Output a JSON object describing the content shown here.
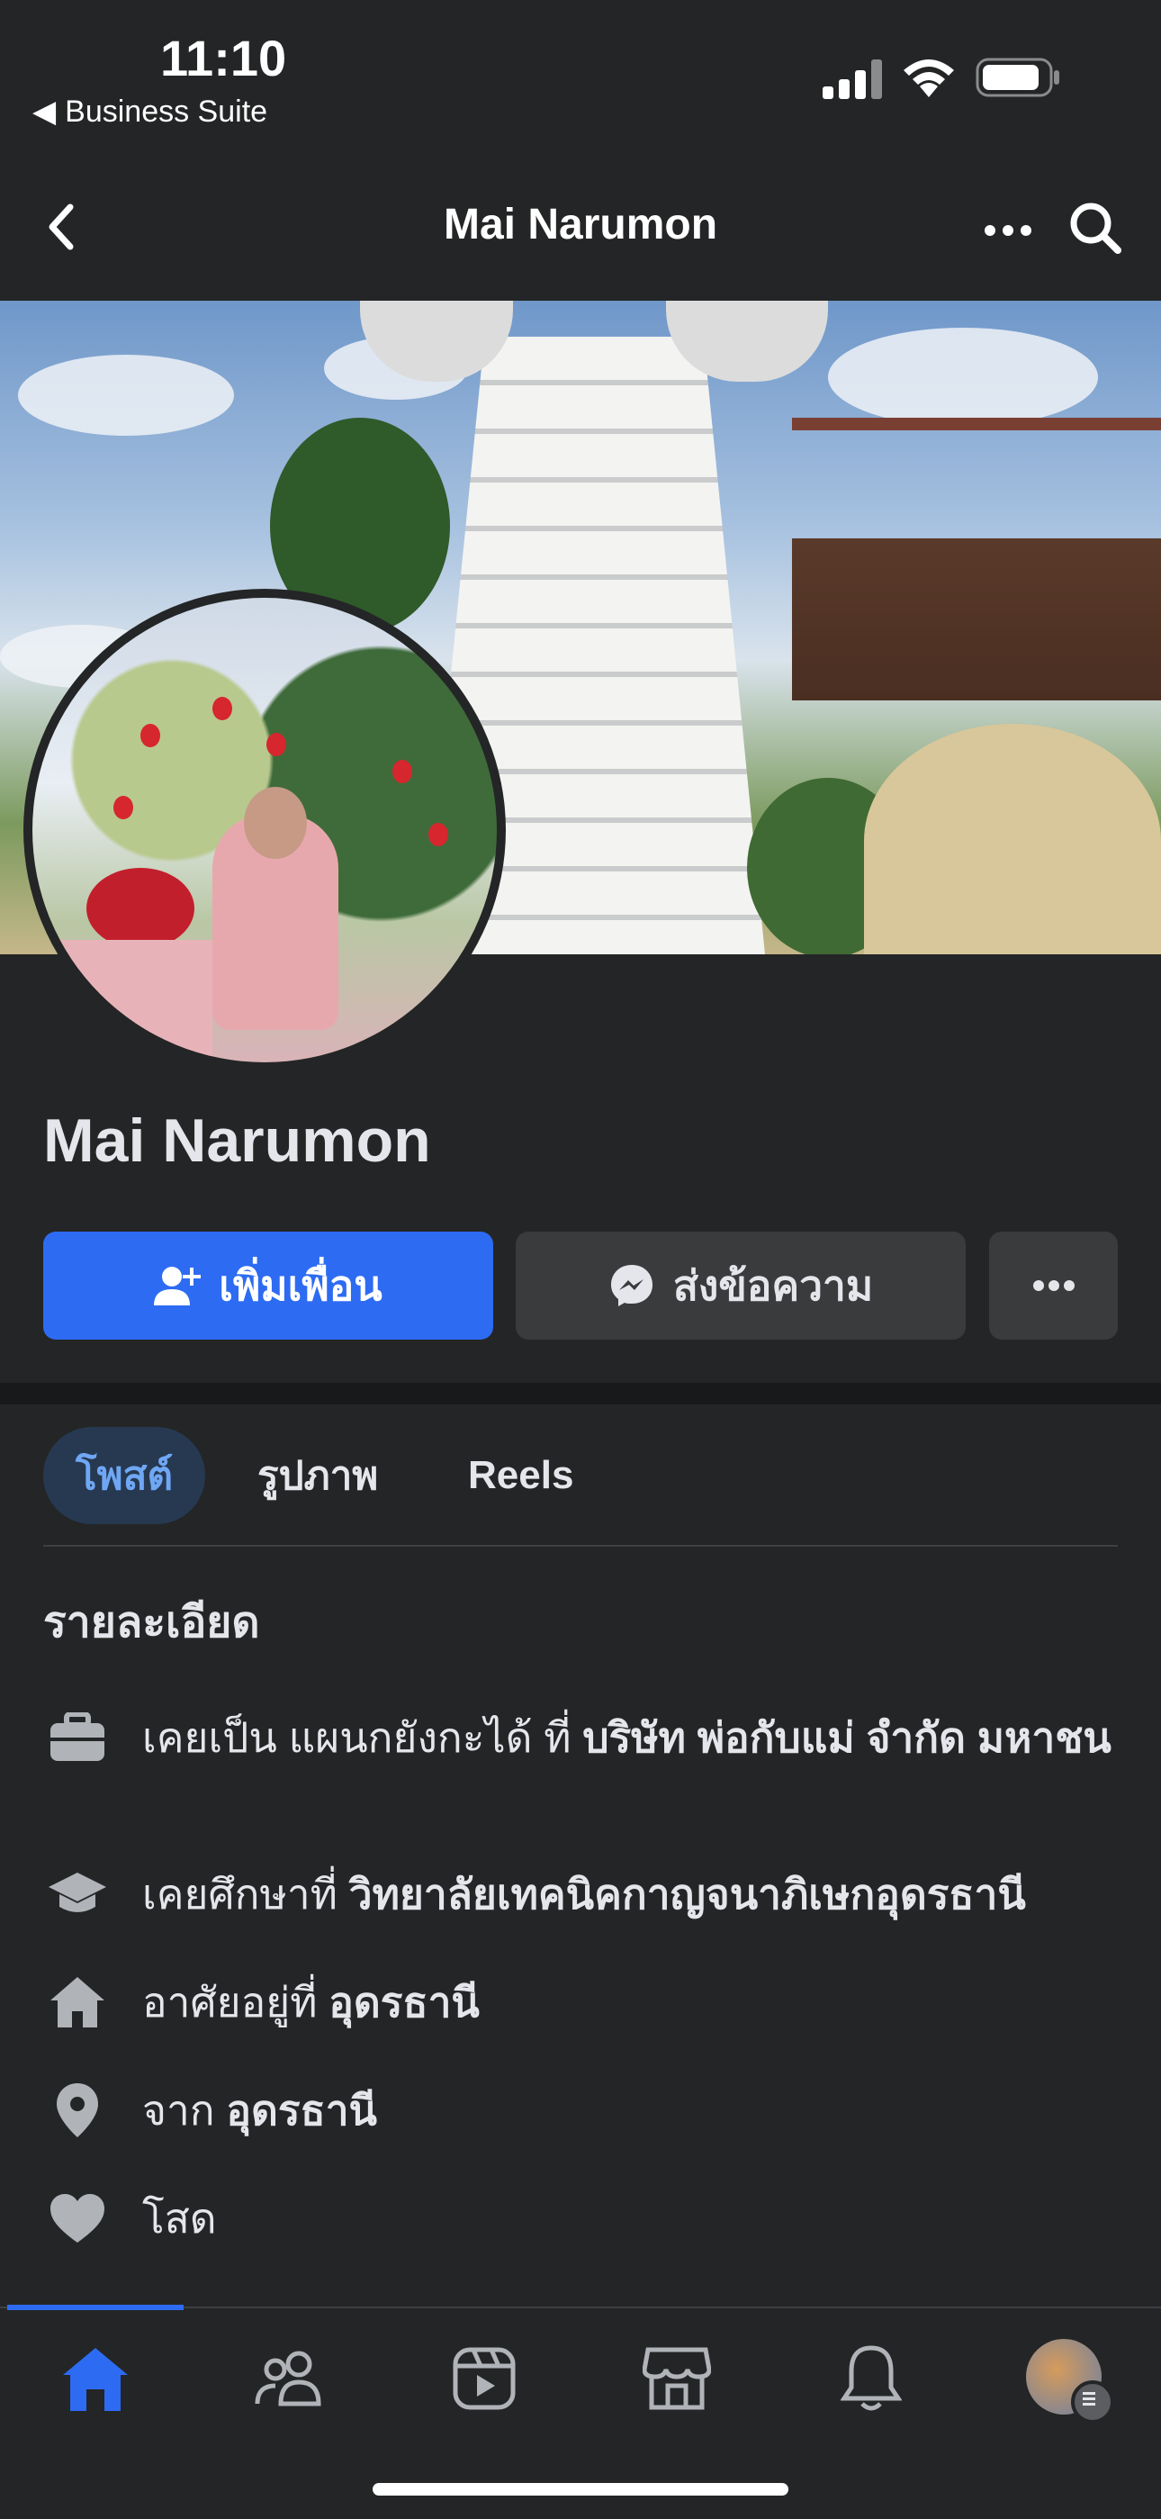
{
  "status_bar": {
    "time": "11:10",
    "back_app": "Business Suite"
  },
  "navbar": {
    "title": "Mai Narumon"
  },
  "profile": {
    "name": "Mai Narumon"
  },
  "actions": {
    "add_friend": "เพิ่มเพื่อน",
    "message": "ส่งข้อความ"
  },
  "tabs": [
    {
      "label": "โพสต์"
    },
    {
      "label": "รูปภาพ"
    },
    {
      "label": "Reels"
    }
  ],
  "details": {
    "heading": "รายละเอียด",
    "work": {
      "prefix": "เคยเป็น แผนกยังกะได้ ที่ ",
      "bold": "บริษัท พ่อกับแม่ จำกัด มหาชน"
    },
    "education": {
      "prefix": "เคยศึกษาที่ ",
      "bold": "วิทยาลัยเทคนิคกาญจนาภิเษกอุดรธานี"
    },
    "lives": {
      "prefix": "อาศัยอยู่ที่ ",
      "bold": "อุดรธานี"
    },
    "from": {
      "prefix": "จาก ",
      "bold": "อุดรธานี"
    },
    "relationship": {
      "text": "โสด"
    }
  },
  "colors": {
    "accent": "#2d6bf2",
    "background": "#242526",
    "button_secondary": "#3a3b3c"
  },
  "bottom_nav": [
    "home-icon",
    "friends-icon",
    "video-icon",
    "marketplace-icon",
    "bell-icon",
    "profile-avatar"
  ]
}
